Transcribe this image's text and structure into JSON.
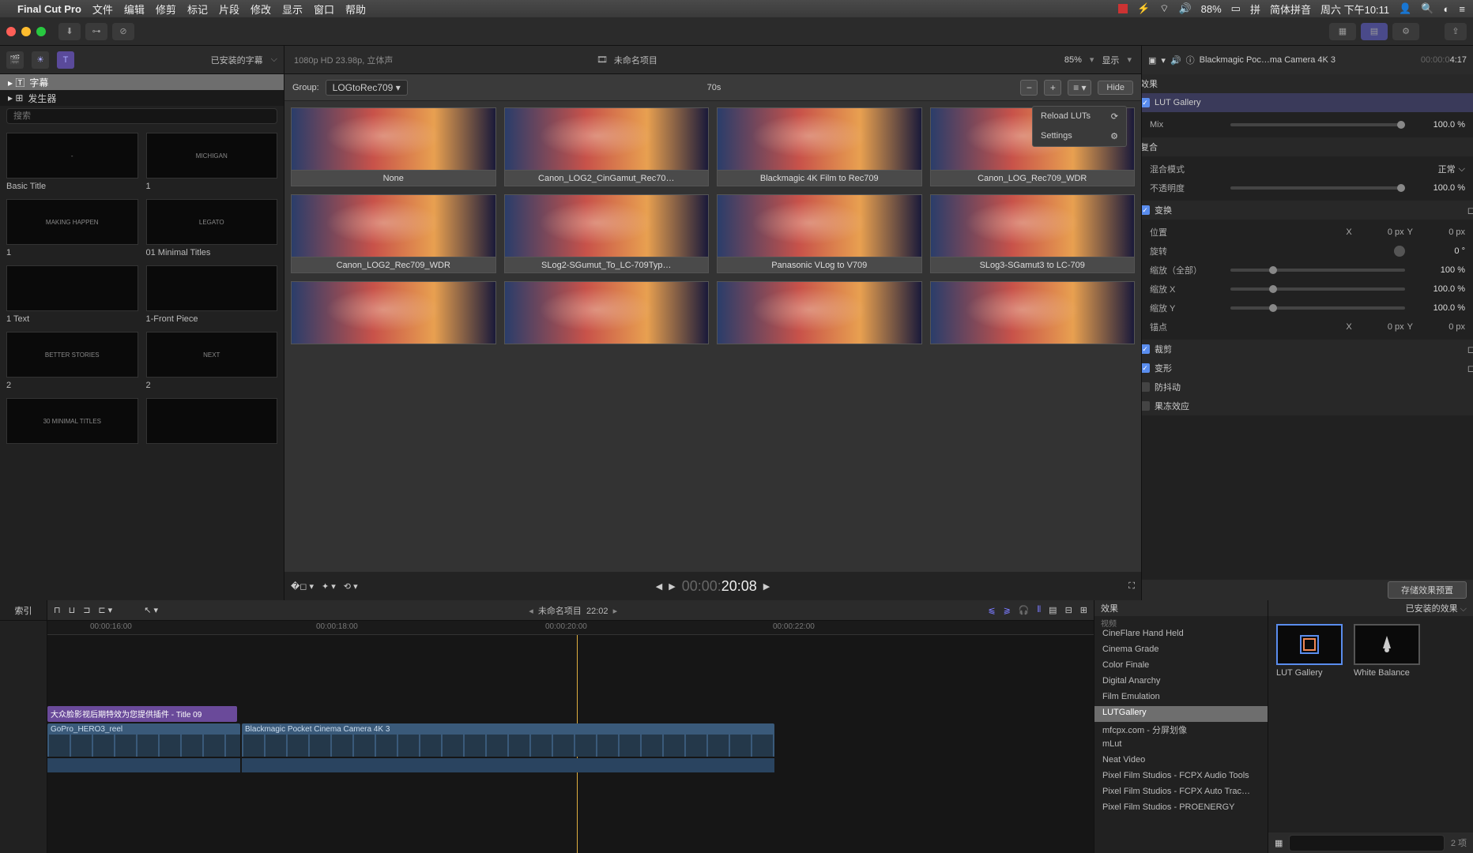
{
  "menubar": {
    "app": "Final Cut Pro",
    "items": [
      "文件",
      "编辑",
      "修剪",
      "标记",
      "片段",
      "修改",
      "显示",
      "窗口",
      "帮助"
    ],
    "battery": "88%",
    "ime": "简体拼音",
    "clock": "周六 下午10:11"
  },
  "toolbar": {},
  "sidebar": {
    "installed_label": "已安装的字幕",
    "tree": [
      "字幕",
      "发生器"
    ],
    "search_ph": "搜索",
    "items": [
      {
        "thumb": "-",
        "cap": "Basic Title"
      },
      {
        "thumb": "MICHIGAN",
        "cap": "1"
      },
      {
        "thumb": "MAKING HAPPEN",
        "cap": "1"
      },
      {
        "thumb": "LEGATO",
        "cap": "01 Minimal Titles"
      },
      {
        "thumb": "",
        "cap": "1 Text"
      },
      {
        "thumb": "",
        "cap": "1-Front Piece"
      },
      {
        "thumb": "BETTER STORIES",
        "cap": "2"
      },
      {
        "thumb": "NEXT",
        "cap": "2"
      },
      {
        "thumb": "30 MINIMAL TITLES",
        "cap": ""
      },
      {
        "thumb": "",
        "cap": ""
      }
    ]
  },
  "center": {
    "format": "1080p HD 23.98p, 立体声",
    "project": "未命名项目",
    "zoom": "85%",
    "view": "显示",
    "group_label": "Group:",
    "group_value": "LOGtoRec709",
    "grid_title": "70s",
    "hide": "Hide",
    "menu": {
      "reload": "Reload LUTs",
      "settings": "Settings"
    },
    "luts_row1": [
      "None",
      "Canon_LOG2_CinGamut_Rec70…",
      "Blackmagic 4K Film to Rec709",
      "Canon_LOG_Rec709_WDR"
    ],
    "luts_row2": [
      "Canon_LOG2_Rec709_WDR",
      "SLog2-SGumut_To_LC-709Typ…",
      "Panasonic VLog to V709",
      "SLog3-SGamut3 to LC-709"
    ],
    "tc_grey": "00:00:",
    "tc": "20:08"
  },
  "inspector": {
    "clip": "Blackmagic Poc…ma Camera 4K 3",
    "tc_grey": "00:00:0",
    "dur": "4:17",
    "effects_h": "效果",
    "gallery_h": "LUT Gallery",
    "mix_l": "Mix",
    "mix_v": "100.0 %",
    "composite_h": "复合",
    "blend_l": "混合模式",
    "blend_v": "正常",
    "opacity_l": "不透明度",
    "opacity_v": "100.0 %",
    "transform_h": "变换",
    "pos_l": "位置",
    "pos_x": "0 px",
    "pos_y": "0 px",
    "rot_l": "旋转",
    "rot_v": "0 °",
    "scale_l": "缩放（全部）",
    "scale_v": "100 %",
    "scalex_l": "缩放 X",
    "scalex_v": "100.0 %",
    "scaley_l": "缩放 Y",
    "scaley_v": "100.0 %",
    "anchor_l": "锚点",
    "anchor_x": "0 px",
    "anchor_y": "0 px",
    "crop_h": "裁剪",
    "distort_h": "变形",
    "stab_h": "防抖动",
    "rolling_h": "果冻效应",
    "save": "存储效果预置"
  },
  "timeline": {
    "index": "索引",
    "project": "未命名项目",
    "dur": "22:02",
    "marks": [
      "00:00:16:00",
      "00:00:18:00",
      "00:00:20:00",
      "00:00:22:00"
    ],
    "title_clip": "大众脸影视后期特效为您提供插件 - Title 09",
    "v1": "GoPro_HERO3_reel",
    "v2": "Blackmagic Pocket Cinema Camera 4K 3"
  },
  "effects": {
    "header": "效果",
    "cat": "视频",
    "installed": "已安装的效果",
    "list": [
      "CineFlare Hand Held",
      "Cinema Grade",
      "Color Finale",
      "Digital Anarchy",
      "Film Emulation",
      "LUTGallery",
      "mfcpx.com - 分屏划像",
      "mLut",
      "Neat Video",
      "Pixel Film Studios - FCPX Audio Tools",
      "Pixel Film Studios - FCPX Auto Trac…",
      "Pixel Film Studios - PROENERGY"
    ],
    "selected_idx": 5,
    "grid": [
      {
        "name": "LUT Gallery"
      },
      {
        "name": "White Balance"
      }
    ],
    "count": "2 项"
  }
}
